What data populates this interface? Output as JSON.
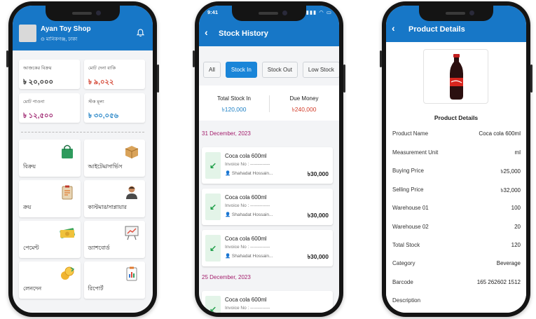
{
  "phone1": {
    "shop_name": "Ayan Toy Shop",
    "shop_location": "মানিকগঞ্জ, ঢাকা",
    "stats": [
      {
        "label": "আজকের বিক্রয়",
        "value": "৳ ২০,০০০",
        "color": "#1a1a1a"
      },
      {
        "label": "মোট দেনা বাকি",
        "value": "৳ ৯,০২২",
        "color": "#d23b28"
      },
      {
        "label": "মোট পাওনা",
        "value": "৳ ১২,৫০০",
        "color": "#9b1e6b"
      },
      {
        "label": "স্টক মূল্য",
        "value": "৳ ৩০,০৫৬",
        "color": "#1b7fc4"
      }
    ],
    "menu": [
      {
        "label": "বিক্রয়",
        "icon": "shopping-bag-icon"
      },
      {
        "label": "আইটেম/সার্ভিস",
        "icon": "box-icon"
      },
      {
        "label": "ক্রয়",
        "icon": "clipboard-icon"
      },
      {
        "label": "কাস্টমার/সাপ্লায়ার",
        "icon": "person-icon"
      },
      {
        "label": "পেমেন্ট",
        "icon": "cash-icon"
      },
      {
        "label": "ড্যাশবোর্ড",
        "icon": "presentation-board-icon"
      },
      {
        "label": "লেনদেন",
        "icon": "coin-exchange-icon"
      },
      {
        "label": "রিপোর্ট",
        "icon": "report-clipboard-icon"
      }
    ]
  },
  "phone2": {
    "time": "9:41",
    "title": "Stock History",
    "filters": [
      "All",
      "Stock In",
      "Stock Out",
      "Low Stock"
    ],
    "active_filter": "Stock In",
    "summary": {
      "left_label": "Total Stock In",
      "left_value": "৳120,000",
      "right_label": "Due Money",
      "right_value": "৳240,000"
    },
    "groups": [
      {
        "date": "31 December, 2023",
        "items": [
          {
            "name": "Coca cola 600ml",
            "invoice": "Invoice No : -------------",
            "user": "Shahadat Hossain...",
            "amount": "৳30,000"
          },
          {
            "name": "Coca cola 600ml",
            "invoice": "Invoice No : -------------",
            "user": "Shahadat Hossain...",
            "amount": "৳30,000"
          },
          {
            "name": "Coca cola 600ml",
            "invoice": "Invoice No : -------------",
            "user": "Shahadat Hossain...",
            "amount": "৳30,000"
          }
        ]
      },
      {
        "date": "25 December, 2023",
        "items": [
          {
            "name": "Coca cola 600ml",
            "invoice": "Invoice No : -------------",
            "user": "",
            "amount": ""
          }
        ]
      }
    ]
  },
  "phone3": {
    "title": "Product Details",
    "section_title": "Product Details",
    "details": [
      {
        "key": "Product Name",
        "value": "Coca cola 600ml"
      },
      {
        "key": "Measurement Unit",
        "value": "ml"
      },
      {
        "key": "Buying Price",
        "value": "৳25,000"
      },
      {
        "key": "Selling Price",
        "value": "৳32,000"
      },
      {
        "key": "Warehouse 01",
        "value": "100"
      },
      {
        "key": "Warehouse 02",
        "value": "20"
      },
      {
        "key": "Total Stock",
        "value": "120"
      },
      {
        "key": "Category",
        "value": "Beverage"
      },
      {
        "key": "Barcode",
        "value": "165 262602 1512"
      },
      {
        "key": "Description",
        "value": ""
      }
    ]
  },
  "colors": {
    "primary": "#1777c7",
    "accent_chip": "#1a85d8",
    "date_header": "#a31c6b",
    "stock_in_green": "#22a04b"
  }
}
